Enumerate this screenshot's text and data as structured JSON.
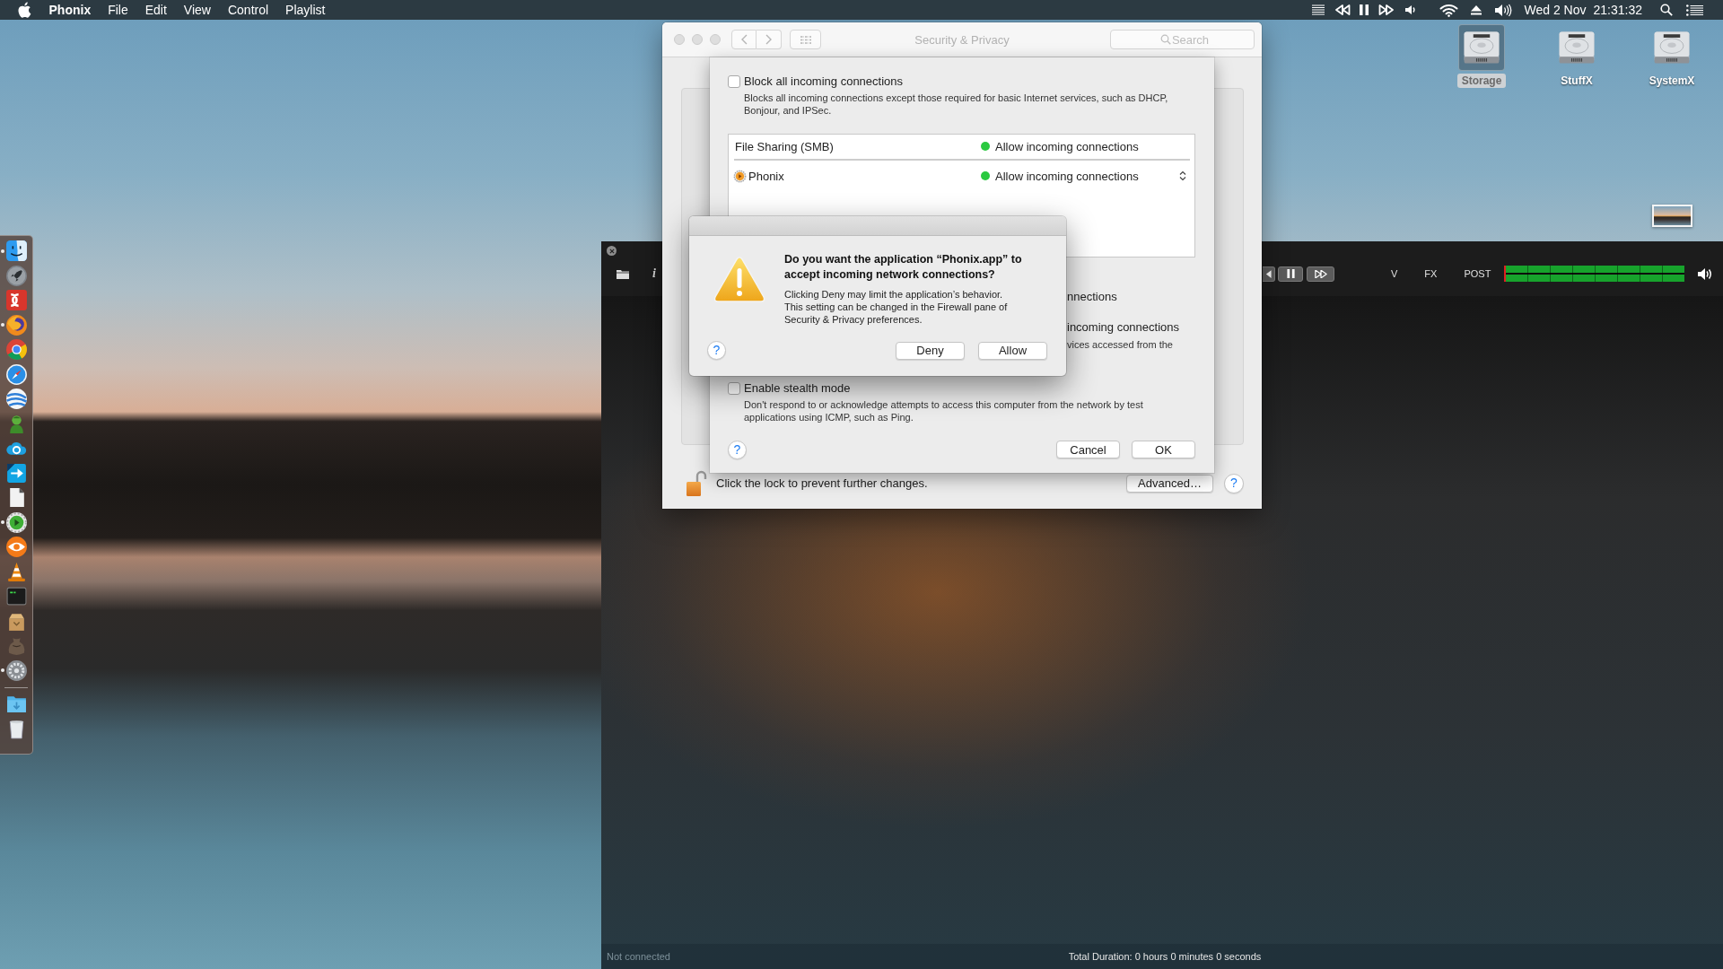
{
  "menu_bar": {
    "app_name": "Phonix",
    "menus": [
      "File",
      "Edit",
      "View",
      "Control",
      "Playlist"
    ],
    "date": "Wed 2 Nov",
    "time": "21:31:32"
  },
  "desktop_icons": [
    {
      "label": "Storage",
      "selected": true
    },
    {
      "label": "StuffX",
      "selected": false
    },
    {
      "label": "SystemX",
      "selected": false
    }
  ],
  "dock": {
    "apps": [
      {
        "running": true
      },
      {
        "running": false
      },
      {
        "running": false
      },
      {
        "running": true
      },
      {
        "running": false
      },
      {
        "running": false
      },
      {
        "running": false
      },
      {
        "running": false
      },
      {
        "running": false
      },
      {
        "running": false
      },
      {
        "running": false
      },
      {
        "running": true
      },
      {
        "running": false
      },
      {
        "running": false
      },
      {
        "running": false
      },
      {
        "running": false
      },
      {
        "running": false
      },
      {
        "running": true
      }
    ],
    "stacks": [
      {
        "kind": "folder"
      },
      {
        "kind": "trash"
      }
    ]
  },
  "player": {
    "info_button": "i",
    "labels": [
      "V",
      "FX",
      "POST"
    ],
    "meter": {
      "level": 1
    },
    "status": "Not connected",
    "total_duration": "Total Duration: 0 hours 0 minutes 0 seconds"
  },
  "security_window": {
    "title": "Security & Privacy",
    "search": {
      "placeholder": "Search"
    },
    "lock_text": "Click the lock to prevent further changes.",
    "advanced_button": "Advanced…",
    "help_button": "?"
  },
  "firewall_sheet": {
    "block_all": {
      "label": "Block all incoming connections",
      "checked": false,
      "description": "Blocks all incoming connections except those required for basic Internet services, such as DHCP, Bonjour, and IPSec."
    },
    "rules": [
      {
        "kind": "service",
        "name": "File Sharing (SMB)",
        "status": "Allow incoming connections",
        "color": "#2ac940"
      },
      {
        "kind": "app",
        "name": "Phonix",
        "status": "Allow incoming connections",
        "color": "#2ac940"
      }
    ],
    "partial_texts": [
      {
        "kind": "option",
        "text": "nnections"
      },
      {
        "kind": "option",
        "text": "incoming connections"
      },
      {
        "kind": "description",
        "text": "vices accessed from the"
      }
    ],
    "stealth_mode": {
      "label": "Enable stealth mode",
      "checked": false,
      "description": "Don't respond to or acknowledge attempts to access this computer from the network by test applications using ICMP, such as Ping."
    },
    "help_button": "?",
    "buttons": [
      "Cancel",
      "OK"
    ]
  },
  "alert": {
    "title": "Do you want the application “Phonix.app” to accept incoming network connections?",
    "message": "Clicking Deny may limit the application’s behavior. This setting can be changed in the Firewall pane of Security & Privacy preferences.",
    "help_button": "?",
    "buttons": [
      "Deny",
      "Allow"
    ]
  }
}
